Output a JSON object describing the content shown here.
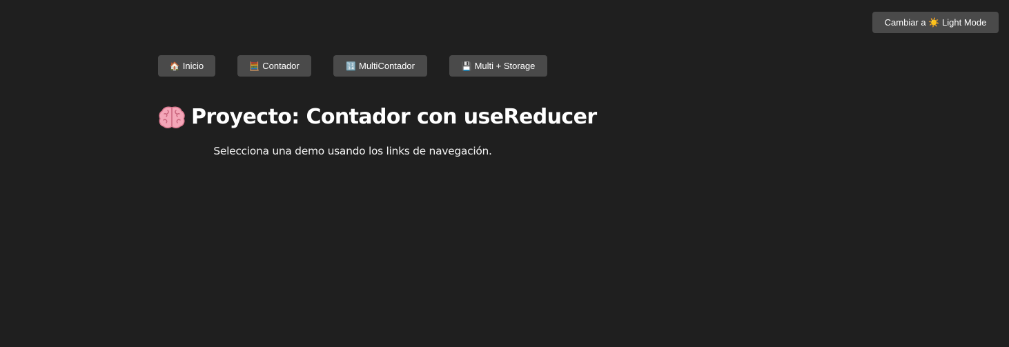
{
  "theme_toggle": {
    "label": "Cambiar a ☀️ Light Mode"
  },
  "nav": {
    "items": [
      {
        "icon": "🏠",
        "label": "Inicio"
      },
      {
        "icon": "🧮",
        "label": "Contador"
      },
      {
        "icon": "🔢",
        "label": "MultiContador"
      },
      {
        "icon": "💾",
        "label": "Multi + Storage"
      }
    ]
  },
  "main": {
    "title_icon": "🧠",
    "title": "Proyecto: Contador con useReducer",
    "subtitle": "Selecciona una demo usando los links de navegación."
  },
  "colors": {
    "background": "#1f1f1f",
    "button_bg": "#4a4a4a",
    "text": "#ffffff"
  }
}
